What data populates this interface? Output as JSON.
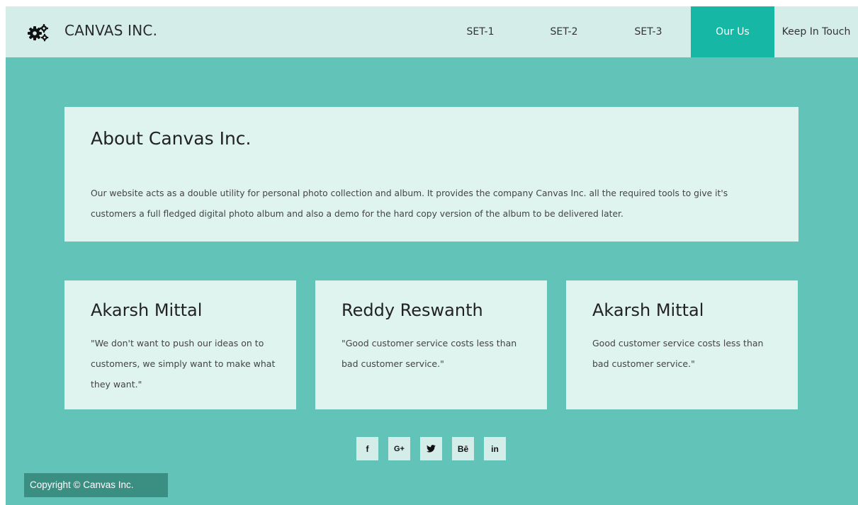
{
  "header": {
    "brand": "CANVAS INC.",
    "logo_icon": "gears-icon",
    "nav": [
      {
        "label": "SET-1",
        "active": false
      },
      {
        "label": "SET-2",
        "active": false
      },
      {
        "label": "SET-3",
        "active": false
      },
      {
        "label": "Our Us",
        "active": true
      },
      {
        "label": "Keep In Touch",
        "active": false
      }
    ]
  },
  "about": {
    "title": "About Canvas Inc.",
    "body": "Our website acts as a double utility for personal photo collection and album. It provides the company Canvas Inc. all the required tools to give it's customers a full fledged digital photo album and also a demo for the hard copy version of the album to be delivered later."
  },
  "people": [
    {
      "name": "Akarsh Mittal",
      "quote": "\"We don't want to push our ideas on to customers, we simply want to make what they want.\""
    },
    {
      "name": "Reddy Reswanth",
      "quote": "\"Good customer service costs less than bad customer service.\""
    },
    {
      "name": "Akarsh Mittal",
      "quote": "Good customer service costs less than bad customer service.\""
    }
  ],
  "social": [
    {
      "icon": "facebook-icon",
      "glyph": "f"
    },
    {
      "icon": "google-plus-icon",
      "glyph": "G+"
    },
    {
      "icon": "twitter-icon",
      "glyph": ""
    },
    {
      "icon": "behance-icon",
      "glyph": "Bē"
    },
    {
      "icon": "linkedin-icon",
      "glyph": "in"
    }
  ],
  "footer": {
    "copyright": "Copyright © Canvas Inc."
  },
  "colors": {
    "page_bg": "#62c4b8",
    "header_bg": "#d4ede9",
    "active_nav": "#17b7a5",
    "card_bg": "#dff3ef",
    "copyright_bg": "#3a8f82"
  }
}
